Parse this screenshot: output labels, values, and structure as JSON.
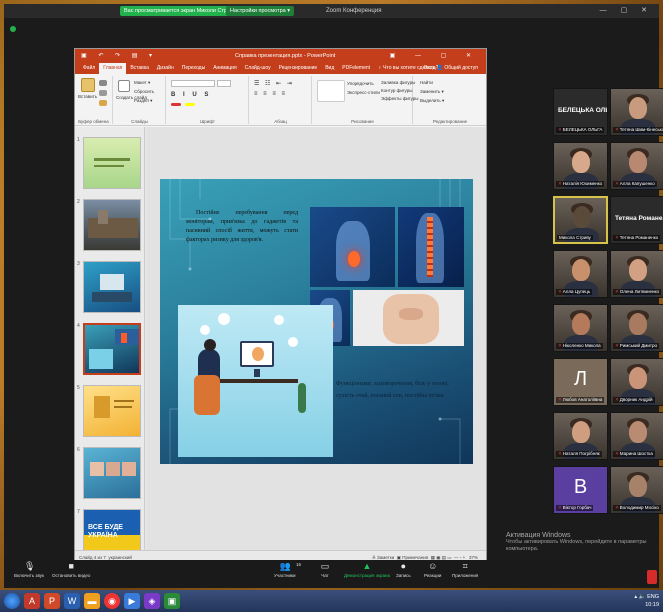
{
  "zoom": {
    "title_pill_1": "Вас просматривается экран Миколи Стриви",
    "title_pill_2": "Настройки просмотра ▾",
    "title": "Zoom Конференция",
    "window_controls": "— ▢ ✕"
  },
  "ppt": {
    "qat": "▣ ↶ ↷ ▤ ▾",
    "document_title": "Справка презентация.pptx - PowerPoint",
    "window_controls": "▣ — ▢ ✕",
    "tabs": [
      "Файл",
      "Главная",
      "Вставка",
      "Дизайн",
      "Переходы",
      "Анимация",
      "Слайд-шоу",
      "Рецензирование",
      "Вид",
      "PDFelement",
      "♀ Что вы хотите сделать?"
    ],
    "active_tab_index": 1,
    "tabs_right": "Вход  👤 Общий доступ",
    "ribbon": {
      "groups": [
        "Буфер обмена",
        "Слайды",
        "Шрифт",
        "Абзац",
        "Рисование",
        "Редактирование"
      ],
      "paste": "Вставить",
      "new_slide": "Создать слайд",
      "layout": "Макет ▾",
      "reset": "Сбросить",
      "section": "Раздел ▾",
      "arrange": "Упорядочить",
      "quick_styles": "Экспресс-стили",
      "shape_fill": "Заливка фигуры",
      "shape_outline": "Контур фигуры",
      "shape_effects": "Эффекты фигуры",
      "find": "Найти",
      "replace": "Заменить ▾",
      "select": "Выделить ▾"
    },
    "thumbnail_numbers": [
      "1",
      "2",
      "3",
      "4",
      "5",
      "6",
      "7"
    ],
    "selected_slide": 4,
    "thumb7_text": "ВСЕ БУДЕ УКРАЇНА",
    "slide": {
      "text": "Постійне перебування перед моніторам, прив'язка до гаджетів та пасивний спосіб життя, можуть стати факторах ризику для здоров'я.",
      "caption": "Функціонами: запаморочення, біль у голові, сухість очей, поганий сон, постійна втома."
    },
    "status": {
      "slide_of": "Слайд 4 из 7",
      "language": "украинский",
      "notes": "≜ Заметки",
      "comments": "▣ Примечания",
      "zoom": "37%"
    }
  },
  "participants": [
    {
      "name": "БЕЛЕЦЬКА ОЛЬГА",
      "bigname": "БЕЛЕЦЬКА ОЛЬ...",
      "muted": true,
      "skin": "#2b2b2b"
    },
    {
      "name": "Тетяна Шим-Кінесько",
      "muted": true,
      "skin": "#c99b7e"
    },
    {
      "name": "Наталія Юхименко",
      "muted": true,
      "skin": "#d7a98a"
    },
    {
      "name": "Алла Капушенко",
      "muted": true,
      "skin": "#b88870"
    },
    {
      "name": "Микола Стриву",
      "muted": false,
      "skin": "#5a4a3a",
      "speaking": true
    },
    {
      "name": "Тетяна Романенко",
      "bigname": "Тетяна Романе...",
      "muted": true,
      "skin": "#2b2b2b"
    },
    {
      "name": "Алла Цупець",
      "muted": true,
      "skin": "#c8916c"
    },
    {
      "name": "Олена Литвиненко",
      "muted": true,
      "skin": "#d2a083"
    },
    {
      "name": "Ніколенко Микола",
      "muted": true,
      "skin": "#b57a5b"
    },
    {
      "name": "Римський Дмитро",
      "muted": true,
      "skin": "#a87a5f"
    },
    {
      "name": "Любов Анатоліївна",
      "letter": "Л",
      "muted": true,
      "skin": "#7a6a5a"
    },
    {
      "name": "Дворник Андрій",
      "muted": true,
      "skin": "#c99478"
    },
    {
      "name": "Наталя Погрібняк",
      "muted": true,
      "skin": "#cf9d80"
    },
    {
      "name": "Марина Шостка",
      "muted": true,
      "skin": "#b98b73"
    },
    {
      "name": "Віктор Горбач",
      "letter": "В",
      "muted": true,
      "skin": "#5b3fa0"
    },
    {
      "name": "Володимир Мосіко",
      "muted": true,
      "skin": "#a7826a"
    }
  ],
  "toolbar": {
    "mute": "Включить звук",
    "video": "Остановить видео",
    "participants": "Участники",
    "participants_count": "16",
    "chat": "Чат",
    "share": "Демонстрация экрана",
    "record": "Запись",
    "reactions": "Реакции",
    "apps": "Приложения"
  },
  "windows_activation": {
    "line1": "Активация Windows",
    "line2": "Чтобы активировать Windows, перейдите в параметры",
    "line3": "компьютера."
  },
  "taskbar": {
    "tray_time": "▴ 🔈 ENG",
    "tray_date": "10:19"
  },
  "colors": {
    "ppt_accent": "#c43e1c",
    "zoom_green": "#23b14d",
    "slide_bg": "#2a7f9c"
  }
}
